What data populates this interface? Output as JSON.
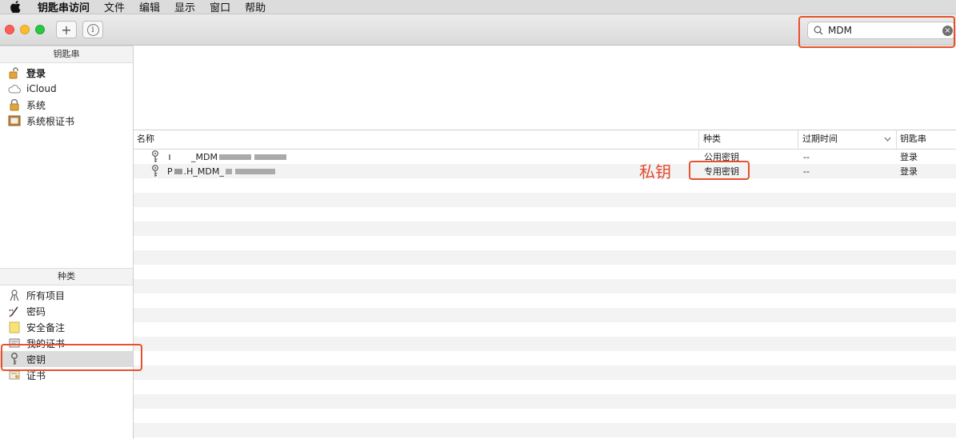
{
  "menubar": {
    "app_name": "钥匙串访问",
    "items": [
      "文件",
      "编辑",
      "显示",
      "窗口",
      "帮助"
    ]
  },
  "toolbar": {
    "add_label": "+",
    "info_label": "i"
  },
  "search": {
    "value": "MDM",
    "clear_label": "×"
  },
  "sidebar": {
    "keychains_header": "钥匙串",
    "keychains": [
      {
        "label": "登录",
        "icon": "padlock-unlocked-icon",
        "bold": true
      },
      {
        "label": "iCloud",
        "icon": "cloud-icon"
      },
      {
        "label": "系统",
        "icon": "padlock-icon"
      },
      {
        "label": "系统根证书",
        "icon": "certificate-cabinet-icon"
      }
    ],
    "categories_header": "种类",
    "categories": [
      {
        "label": "所有项目",
        "icon": "all-items-icon"
      },
      {
        "label": "密码",
        "icon": "password-pen-icon"
      },
      {
        "label": "安全备注",
        "icon": "secure-note-icon"
      },
      {
        "label": "我的证书",
        "icon": "my-certificate-icon"
      },
      {
        "label": "密钥",
        "icon": "key-icon",
        "selected": true
      },
      {
        "label": "证书",
        "icon": "certificate-icon"
      }
    ]
  },
  "table": {
    "columns": {
      "name": "名称",
      "kind": "种类",
      "date": "过期时间",
      "keychain": "钥匙串"
    },
    "rows": [
      {
        "name_prefix": "",
        "name_mid": "_MDM",
        "kind": "公用密钥",
        "date": "--",
        "keychain": "登录"
      },
      {
        "name_prefix": "P",
        "name_mid": ".H_MDM_",
        "kind": "专用密钥",
        "date": "--",
        "keychain": "登录"
      }
    ]
  },
  "annotation": {
    "label": "私钥",
    "color": "#e8502d"
  }
}
